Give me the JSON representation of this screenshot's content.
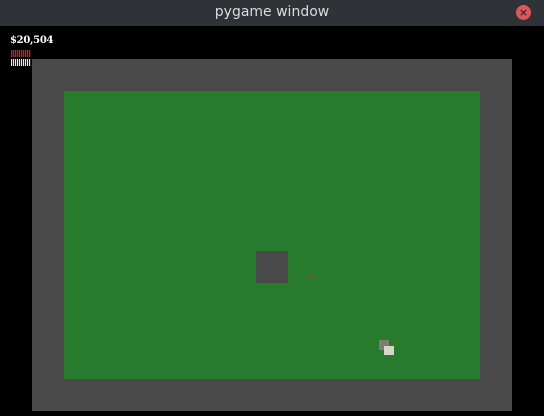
{
  "window": {
    "title": "pygame window",
    "close_symbol": "×"
  },
  "hud": {
    "money": "$20,504",
    "health_level": 1.0,
    "ammo_level": 1.0
  },
  "scene": {
    "icons": {
      "close": "close-icon",
      "obstacle": "obstacle-block",
      "player": "player-unit"
    }
  },
  "colors": {
    "titlebar": "#2f3338",
    "close_button": "#e0545a",
    "wall": "#4a4a4a",
    "grass": "#287a2c",
    "health_bar": "#b42a2a",
    "ammo_bar": "#e8e8e8",
    "pellet": "#8a4a1e",
    "player_back": "#7d7d73",
    "player_front": "#d8d6c8"
  }
}
